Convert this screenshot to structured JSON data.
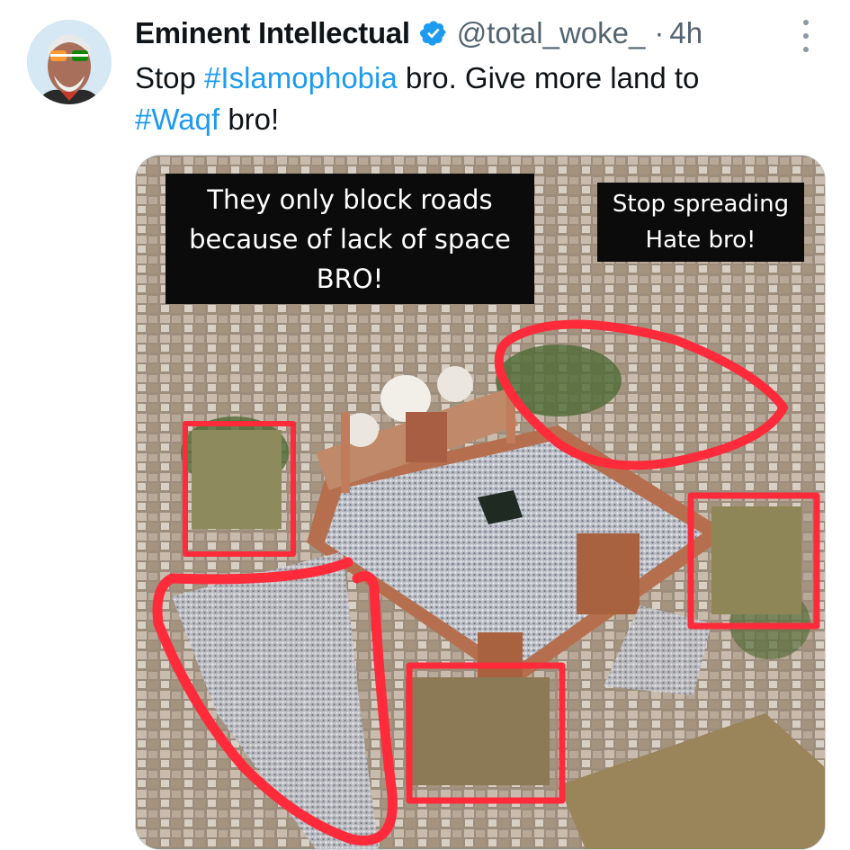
{
  "author": {
    "display_name": "Eminent Intellectual",
    "handle": "@total_woke_",
    "separator": "·",
    "time_ago": "4h",
    "verified_icon": "verified-badge-icon",
    "verified_color": "#1d9bf0"
  },
  "tweet": {
    "text_parts": [
      {
        "text": "Stop ",
        "type": "plain"
      },
      {
        "text": "#Islamophobia",
        "type": "hashtag"
      },
      {
        "text": " bro. Give more land to ",
        "type": "plain"
      },
      {
        "text": "#Waqf",
        "type": "hashtag"
      },
      {
        "text": " bro!",
        "type": "plain"
      }
    ],
    "hashtag_color": "#1d9bf0"
  },
  "media": {
    "caption_left": "They only block roads\nbecause of lack of space\nBRO!",
    "caption_right": "Stop spreading\nHate bro!",
    "annotation_color": "#ff2a3a"
  },
  "icons": {
    "more": "more-vertical-icon"
  }
}
